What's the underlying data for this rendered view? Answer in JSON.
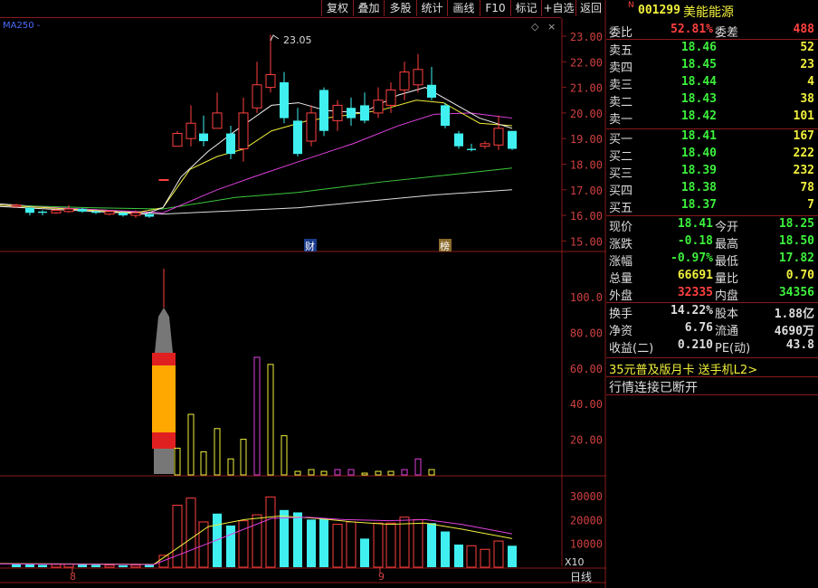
{
  "toolbar": {
    "items": [
      "复权",
      "叠加",
      "多股",
      "统计",
      "画线",
      "F10",
      "标记",
      "+自选",
      "返回"
    ]
  },
  "chart": {
    "ma_label": "MA250",
    "ma_label_suffix": "-",
    "price_ticks": [
      "23.00",
      "22.00",
      "21.00",
      "20.00",
      "19.00",
      "18.00",
      "17.00",
      "16.00",
      "15.00"
    ],
    "high_label": "23.05",
    "vol_ticks": [
      "100.0",
      "80.00",
      "60.00",
      "40.00",
      "20.00"
    ],
    "vol2_ticks": [
      "30000",
      "20000",
      "10000"
    ],
    "vol2_unit": "X10",
    "date_labels": [
      "8",
      "9"
    ],
    "event_labels": [
      "财",
      "榜"
    ],
    "period": "日线"
  },
  "stock": {
    "code": "001299",
    "name": "美能能源",
    "marker": "N"
  },
  "weibi": {
    "label": "委比",
    "value": "52.81%",
    "diff_label": "委差",
    "diff": "488"
  },
  "asks": [
    {
      "label": "卖五",
      "price": "18.46",
      "vol": "52"
    },
    {
      "label": "卖四",
      "price": "18.45",
      "vol": "23"
    },
    {
      "label": "卖三",
      "price": "18.44",
      "vol": "4"
    },
    {
      "label": "卖二",
      "price": "18.43",
      "vol": "38"
    },
    {
      "label": "卖一",
      "price": "18.42",
      "vol": "101"
    }
  ],
  "bids": [
    {
      "label": "买一",
      "price": "18.41",
      "vol": "167"
    },
    {
      "label": "买二",
      "price": "18.40",
      "vol": "222"
    },
    {
      "label": "买三",
      "price": "18.39",
      "vol": "232"
    },
    {
      "label": "买四",
      "price": "18.38",
      "vol": "78"
    },
    {
      "label": "买五",
      "price": "18.37",
      "vol": "7"
    }
  ],
  "quote": [
    {
      "l1": "现价",
      "v1": "18.41",
      "c1": "#3cf03c",
      "l2": "今开",
      "v2": "18.25",
      "c2": "#3cf03c"
    },
    {
      "l1": "涨跌",
      "v1": "-0.18",
      "c1": "#3cf03c",
      "l2": "最高",
      "v2": "18.50",
      "c2": "#3cf03c"
    },
    {
      "l1": "涨幅",
      "v1": "-0.97%",
      "c1": "#3cf03c",
      "l2": "最低",
      "v2": "17.82",
      "c2": "#3cf03c"
    },
    {
      "l1": "总量",
      "v1": "66691",
      "c1": "#f0f03c",
      "l2": "量比",
      "v2": "0.70",
      "c2": "#f0f03c"
    },
    {
      "l1": "外盘",
      "v1": "32335",
      "c1": "#ff4040",
      "l2": "内盘",
      "v2": "34356",
      "c2": "#3cf03c"
    }
  ],
  "stats": [
    {
      "l1": "换手",
      "v1": "14.22%",
      "l2": "股本",
      "v2": "1.88亿"
    },
    {
      "l1": "净资",
      "v1": "6.76",
      "l2": "流通",
      "v2": "4690万"
    },
    {
      "l1": "收益(二)",
      "v1": "0.210",
      "l2": "PE(动)",
      "v2": "43.8"
    }
  ],
  "promo": "35元普及版月卡 送手机L2>",
  "status": "行情连接已断开",
  "colors": {
    "up": "#ff4040",
    "down": "#40f0f0",
    "accent": "#f0f03c",
    "grid": "#8a1a1a"
  }
}
